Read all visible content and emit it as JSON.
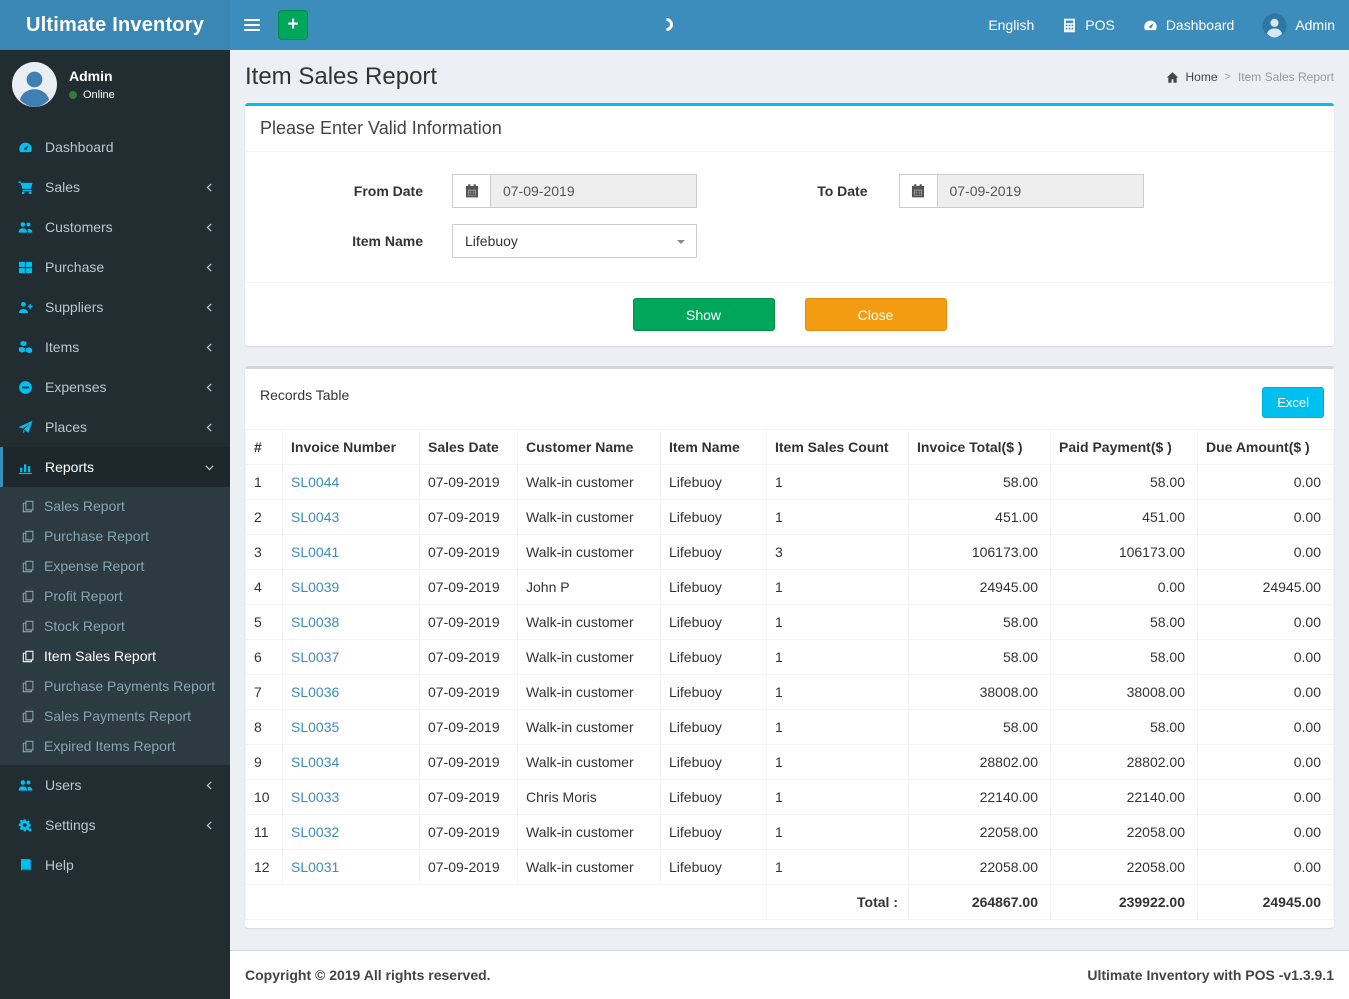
{
  "app": {
    "title": "Ultimate Inventory"
  },
  "colors": {
    "header_blue": "#3c8dbc",
    "sidebar_dark": "#222d32",
    "accent_cyan": "#00c0ef",
    "success_green": "#00a65a",
    "warning_orange": "#f39c12",
    "online_green": "#3c763d",
    "link_blue": "#3c8dbc"
  },
  "navbar": {
    "items": [
      {
        "label": "English",
        "icon": null
      },
      {
        "label": "POS",
        "icon": "calculator-icon"
      },
      {
        "label": "Dashboard",
        "icon": "dashboard-icon"
      },
      {
        "label": "Admin",
        "icon": "user-avatar-icon"
      }
    ]
  },
  "user_panel": {
    "name": "Admin",
    "status": "Online"
  },
  "sidebar": {
    "items": [
      {
        "label": "Dashboard",
        "icon": "tachometer-icon",
        "chevron": "none",
        "active": false
      },
      {
        "label": "Sales",
        "icon": "cart-icon",
        "chevron": "left",
        "active": false
      },
      {
        "label": "Customers",
        "icon": "users-icon",
        "chevron": "left",
        "active": false
      },
      {
        "label": "Purchase",
        "icon": "grid-icon",
        "chevron": "left",
        "active": false
      },
      {
        "label": "Suppliers",
        "icon": "user-plus-icon",
        "chevron": "left",
        "active": false
      },
      {
        "label": "Items",
        "icon": "cubes-icon",
        "chevron": "left",
        "active": false
      },
      {
        "label": "Expenses",
        "icon": "minus-circle-icon",
        "chevron": "left",
        "active": false
      },
      {
        "label": "Places",
        "icon": "paper-plane-icon",
        "chevron": "left",
        "active": false
      },
      {
        "label": "Reports",
        "icon": "bar-chart-icon",
        "chevron": "down",
        "active": true,
        "children": [
          {
            "label": "Sales Report",
            "active": false
          },
          {
            "label": "Purchase Report",
            "active": false
          },
          {
            "label": "Expense Report",
            "active": false
          },
          {
            "label": "Profit Report",
            "active": false
          },
          {
            "label": "Stock Report",
            "active": false
          },
          {
            "label": "Item Sales Report",
            "active": true
          },
          {
            "label": "Purchase Payments Report",
            "active": false
          },
          {
            "label": "Sales Payments Report",
            "active": false
          },
          {
            "label": "Expired Items Report",
            "active": false
          }
        ]
      },
      {
        "label": "Users",
        "icon": "users-icon",
        "chevron": "left",
        "active": false
      },
      {
        "label": "Settings",
        "icon": "gears-icon",
        "chevron": "left",
        "active": false
      },
      {
        "label": "Help",
        "icon": "book-icon",
        "chevron": "none",
        "active": false
      }
    ]
  },
  "page": {
    "title": "Item Sales Report",
    "breadcrumb": {
      "home_label": "Home",
      "separator": ">",
      "current": "Item Sales Report"
    }
  },
  "filter": {
    "title": "Please Enter Valid Information",
    "from_label": "From Date",
    "from_value": "07-09-2019",
    "to_label": "To Date",
    "to_value": "07-09-2019",
    "item_label": "Item Name",
    "item_value": "Lifebuoy",
    "show_label": "Show",
    "close_label": "Close"
  },
  "records": {
    "title": "Records Table",
    "excel_label": "Excel",
    "columns": [
      "#",
      "Invoice Number",
      "Sales Date",
      "Customer Name",
      "Item Name",
      "Item Sales Count",
      "Invoice Total($ )",
      "Paid Payment($ )",
      "Due Amount($ )"
    ],
    "rows": [
      {
        "num": "1",
        "invoice": "SL0044",
        "date": "07-09-2019",
        "customer": "Walk-in customer",
        "item": "Lifebuoy",
        "count": "1",
        "total": "58.00",
        "paid": "58.00",
        "due": "0.00"
      },
      {
        "num": "2",
        "invoice": "SL0043",
        "date": "07-09-2019",
        "customer": "Walk-in customer",
        "item": "Lifebuoy",
        "count": "1",
        "total": "451.00",
        "paid": "451.00",
        "due": "0.00"
      },
      {
        "num": "3",
        "invoice": "SL0041",
        "date": "07-09-2019",
        "customer": "Walk-in customer",
        "item": "Lifebuoy",
        "count": "3",
        "total": "106173.00",
        "paid": "106173.00",
        "due": "0.00"
      },
      {
        "num": "4",
        "invoice": "SL0039",
        "date": "07-09-2019",
        "customer": "John P",
        "item": "Lifebuoy",
        "count": "1",
        "total": "24945.00",
        "paid": "0.00",
        "due": "24945.00"
      },
      {
        "num": "5",
        "invoice": "SL0038",
        "date": "07-09-2019",
        "customer": "Walk-in customer",
        "item": "Lifebuoy",
        "count": "1",
        "total": "58.00",
        "paid": "58.00",
        "due": "0.00"
      },
      {
        "num": "6",
        "invoice": "SL0037",
        "date": "07-09-2019",
        "customer": "Walk-in customer",
        "item": "Lifebuoy",
        "count": "1",
        "total": "58.00",
        "paid": "58.00",
        "due": "0.00"
      },
      {
        "num": "7",
        "invoice": "SL0036",
        "date": "07-09-2019",
        "customer": "Walk-in customer",
        "item": "Lifebuoy",
        "count": "1",
        "total": "38008.00",
        "paid": "38008.00",
        "due": "0.00"
      },
      {
        "num": "8",
        "invoice": "SL0035",
        "date": "07-09-2019",
        "customer": "Walk-in customer",
        "item": "Lifebuoy",
        "count": "1",
        "total": "58.00",
        "paid": "58.00",
        "due": "0.00"
      },
      {
        "num": "9",
        "invoice": "SL0034",
        "date": "07-09-2019",
        "customer": "Walk-in customer",
        "item": "Lifebuoy",
        "count": "1",
        "total": "28802.00",
        "paid": "28802.00",
        "due": "0.00"
      },
      {
        "num": "10",
        "invoice": "SL0033",
        "date": "07-09-2019",
        "customer": "Chris Moris",
        "item": "Lifebuoy",
        "count": "1",
        "total": "22140.00",
        "paid": "22140.00",
        "due": "0.00"
      },
      {
        "num": "11",
        "invoice": "SL0032",
        "date": "07-09-2019",
        "customer": "Walk-in customer",
        "item": "Lifebuoy",
        "count": "1",
        "total": "22058.00",
        "paid": "22058.00",
        "due": "0.00"
      },
      {
        "num": "12",
        "invoice": "SL0031",
        "date": "07-09-2019",
        "customer": "Walk-in customer",
        "item": "Lifebuoy",
        "count": "1",
        "total": "22058.00",
        "paid": "22058.00",
        "due": "0.00"
      }
    ],
    "total_label": "Total :",
    "totals": {
      "invoice_total": "264867.00",
      "paid_payment": "239922.00",
      "due_amount": "24945.00"
    }
  },
  "footer": {
    "copyright": "Copyright © 2019 All rights reserved.",
    "version": "Ultimate Inventory with POS -v1.3.9.1"
  }
}
